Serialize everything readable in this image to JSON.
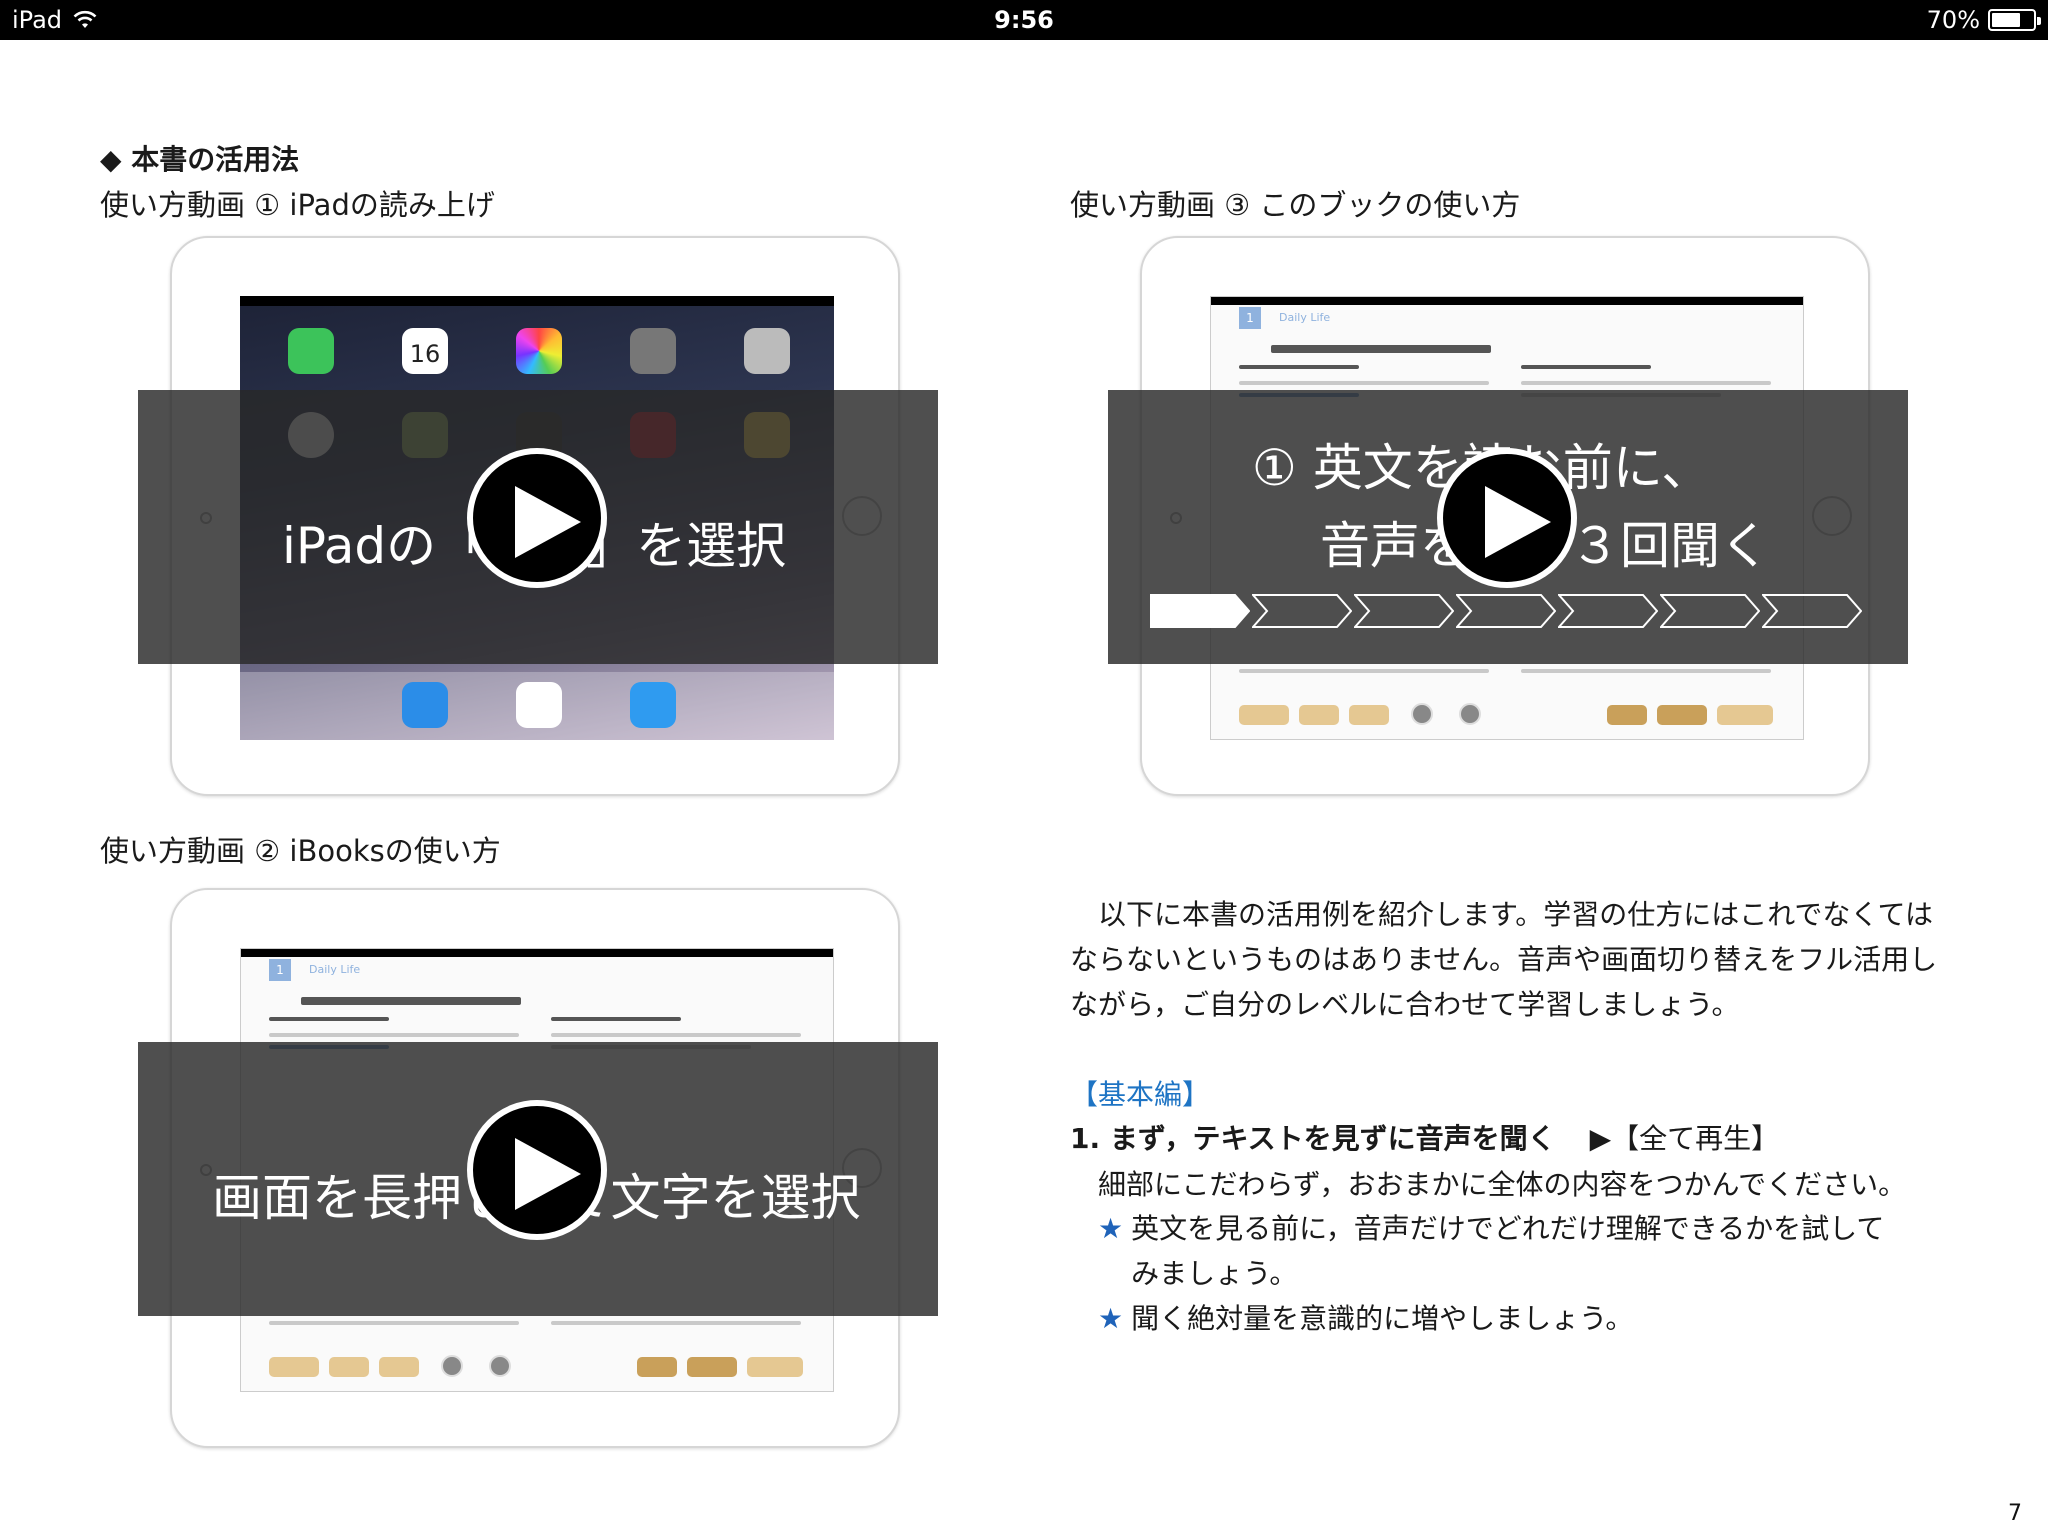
{
  "status_bar": {
    "device": "iPad",
    "time": "9:56",
    "battery": "70%",
    "battery_level": 0.7
  },
  "section_title": "◆ 本書の活用法",
  "videos": [
    {
      "caption": "使い方動画 ① iPadの読み上げ",
      "overlay": "iPadの「設定」を選択"
    },
    {
      "caption": "使い方動画 ② iBooksの使い方",
      "overlay": "画面を長押しして文字を選択"
    },
    {
      "caption": "使い方動画 ③ このブックの使い方",
      "overlay_line1": "① 英文を読む前に、",
      "overlay_line2": "音声を２〜３回聞く"
    }
  ],
  "mini_screens": {
    "home_date": "16",
    "book_header": "Daily Life",
    "book_badge": "1"
  },
  "body": {
    "intro": "以下に本書の活用例を紹介します。学習の仕方にはこれでなくてはならないというものはありません。音声や画面切り替えをフル活用しながら，ご自分のレベルに合わせて学習しましょう。",
    "basic_label": "【基本編】",
    "step1_title": "1. まず，テキストを見ずに音声を聞く",
    "step1_action": "▶【全て再生】",
    "step1_desc": "細部にこだわらず，おおまかに全体の内容をつかんでください。",
    "tip1": "英文を見る前に，音声だけでどれだけ理解できるかを試してみましょう。",
    "tip2": "聞く絶対量を意識的に増やしましょう。"
  },
  "page_number": "7",
  "colors": {
    "accent_blue": "#1e74c4",
    "star_blue": "#1f63b9",
    "gold": "#c9a05a"
  }
}
